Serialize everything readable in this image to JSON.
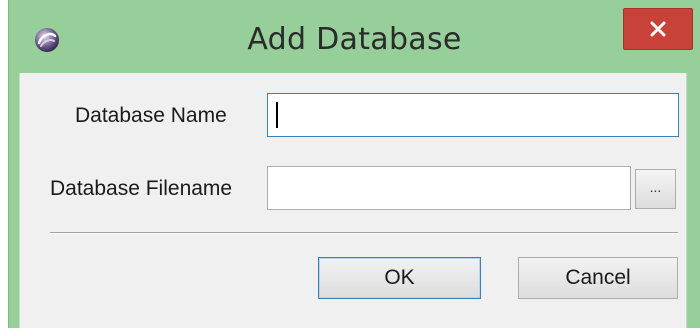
{
  "window": {
    "title": "Add Database",
    "app_icon": "app-logo-icon",
    "close_icon": "close-icon",
    "colors": {
      "titlebar": "#97cf9a",
      "close_button": "#c9423a",
      "client": "#f0f0f0"
    }
  },
  "form": {
    "database_name": {
      "label": "Database Name",
      "value": ""
    },
    "database_filename": {
      "label": "Database Filename",
      "value": "",
      "browse_label": "..."
    }
  },
  "buttons": {
    "ok": "OK",
    "cancel": "Cancel"
  }
}
